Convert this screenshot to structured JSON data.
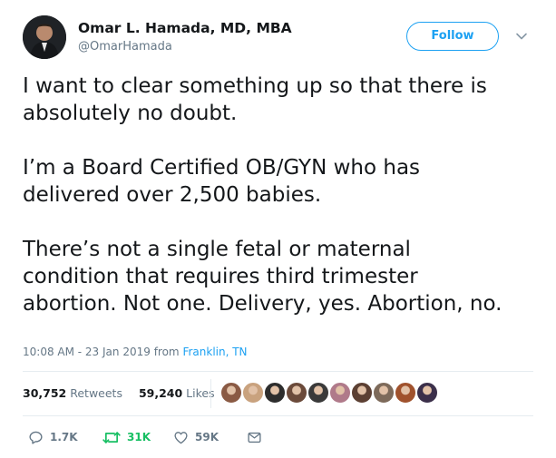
{
  "author": {
    "name": "Omar L. Hamada, MD, MBA",
    "handle": "@OmarHamada"
  },
  "follow_button": {
    "label": "Follow"
  },
  "tweet": {
    "lines_para1": [
      "I want to clear something up so that there is",
      "absolutely no doubt."
    ],
    "lines_para2": [
      "I’m a Board Certified OB/GYN who has",
      "delivered over 2,500 babies."
    ],
    "lines_para3": [
      "There’s not a single fetal or maternal",
      "condition that requires third trimester",
      "abortion. Not one. Delivery, yes. Abortion, no."
    ]
  },
  "meta": {
    "timestamp": "10:08 AM - 23 Jan 2019",
    "from_label": "from",
    "location": "Franklin, TN"
  },
  "stats": {
    "retweets_count": "30,752",
    "retweets_label": "Retweets",
    "likes_count": "59,240",
    "likes_label": "Likes"
  },
  "likers_colors": [
    "#8a5a44",
    "#c9a27e",
    "#2d2d2d",
    "#6b4a3a",
    "#3a3a3a",
    "#b07a8a",
    "#5c4033",
    "#7d6a5a",
    "#a0522d",
    "#3b2f4a"
  ],
  "actions": {
    "reply_count": "1.7K",
    "retweet_count": "31K",
    "like_count": "59K"
  },
  "colors": {
    "accent": "#1da1f2",
    "retweet_green": "#17bf63",
    "muted": "#657786"
  }
}
